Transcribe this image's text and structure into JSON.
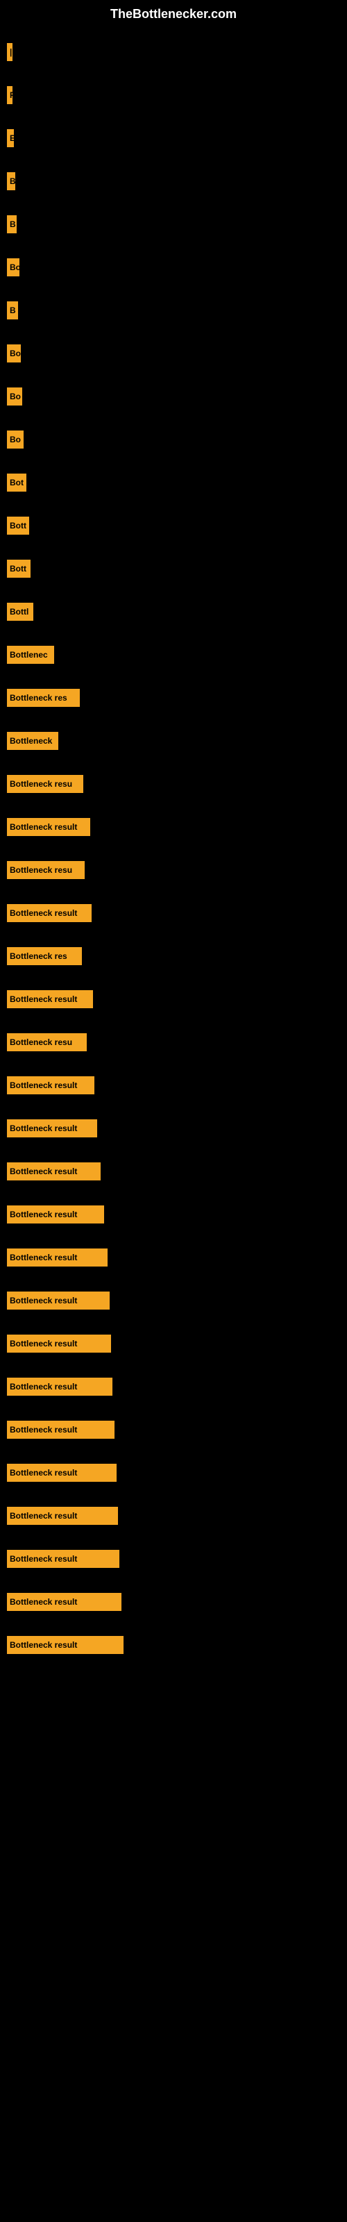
{
  "site": {
    "title": "TheBottlenecker.com"
  },
  "bars": [
    {
      "id": 1,
      "label": "|",
      "width": 4
    },
    {
      "id": 2,
      "label": "P",
      "width": 8
    },
    {
      "id": 3,
      "label": "E",
      "width": 10
    },
    {
      "id": 4,
      "label": "B",
      "width": 12
    },
    {
      "id": 5,
      "label": "B",
      "width": 14
    },
    {
      "id": 6,
      "label": "Bo",
      "width": 18
    },
    {
      "id": 7,
      "label": "B",
      "width": 16
    },
    {
      "id": 8,
      "label": "Bo",
      "width": 20
    },
    {
      "id": 9,
      "label": "Bo",
      "width": 22
    },
    {
      "id": 10,
      "label": "Bo",
      "width": 24
    },
    {
      "id": 11,
      "label": "Bot",
      "width": 28
    },
    {
      "id": 12,
      "label": "Bott",
      "width": 32
    },
    {
      "id": 13,
      "label": "Bott",
      "width": 34
    },
    {
      "id": 14,
      "label": "Bottl",
      "width": 38
    },
    {
      "id": 15,
      "label": "Bottlenec",
      "width": 68
    },
    {
      "id": 16,
      "label": "Bottleneck res",
      "width": 105
    },
    {
      "id": 17,
      "label": "Bottleneck",
      "width": 74
    },
    {
      "id": 18,
      "label": "Bottleneck resu",
      "width": 110
    },
    {
      "id": 19,
      "label": "Bottleneck result",
      "width": 120
    },
    {
      "id": 20,
      "label": "Bottleneck resu",
      "width": 112
    },
    {
      "id": 21,
      "label": "Bottleneck result",
      "width": 122
    },
    {
      "id": 22,
      "label": "Bottleneck res",
      "width": 108
    },
    {
      "id": 23,
      "label": "Bottleneck result",
      "width": 124
    },
    {
      "id": 24,
      "label": "Bottleneck resu",
      "width": 115
    },
    {
      "id": 25,
      "label": "Bottleneck result",
      "width": 126
    },
    {
      "id": 26,
      "label": "Bottleneck result",
      "width": 130
    },
    {
      "id": 27,
      "label": "Bottleneck result",
      "width": 135
    },
    {
      "id": 28,
      "label": "Bottleneck result",
      "width": 140
    },
    {
      "id": 29,
      "label": "Bottleneck result",
      "width": 145
    },
    {
      "id": 30,
      "label": "Bottleneck result",
      "width": 148
    },
    {
      "id": 31,
      "label": "Bottleneck result",
      "width": 150
    },
    {
      "id": 32,
      "label": "Bottleneck result",
      "width": 152
    },
    {
      "id": 33,
      "label": "Bottleneck result",
      "width": 155
    },
    {
      "id": 34,
      "label": "Bottleneck result",
      "width": 158
    },
    {
      "id": 35,
      "label": "Bottleneck result",
      "width": 160
    },
    {
      "id": 36,
      "label": "Bottleneck result",
      "width": 162
    },
    {
      "id": 37,
      "label": "Bottleneck result",
      "width": 165
    },
    {
      "id": 38,
      "label": "Bottleneck result",
      "width": 168
    }
  ]
}
